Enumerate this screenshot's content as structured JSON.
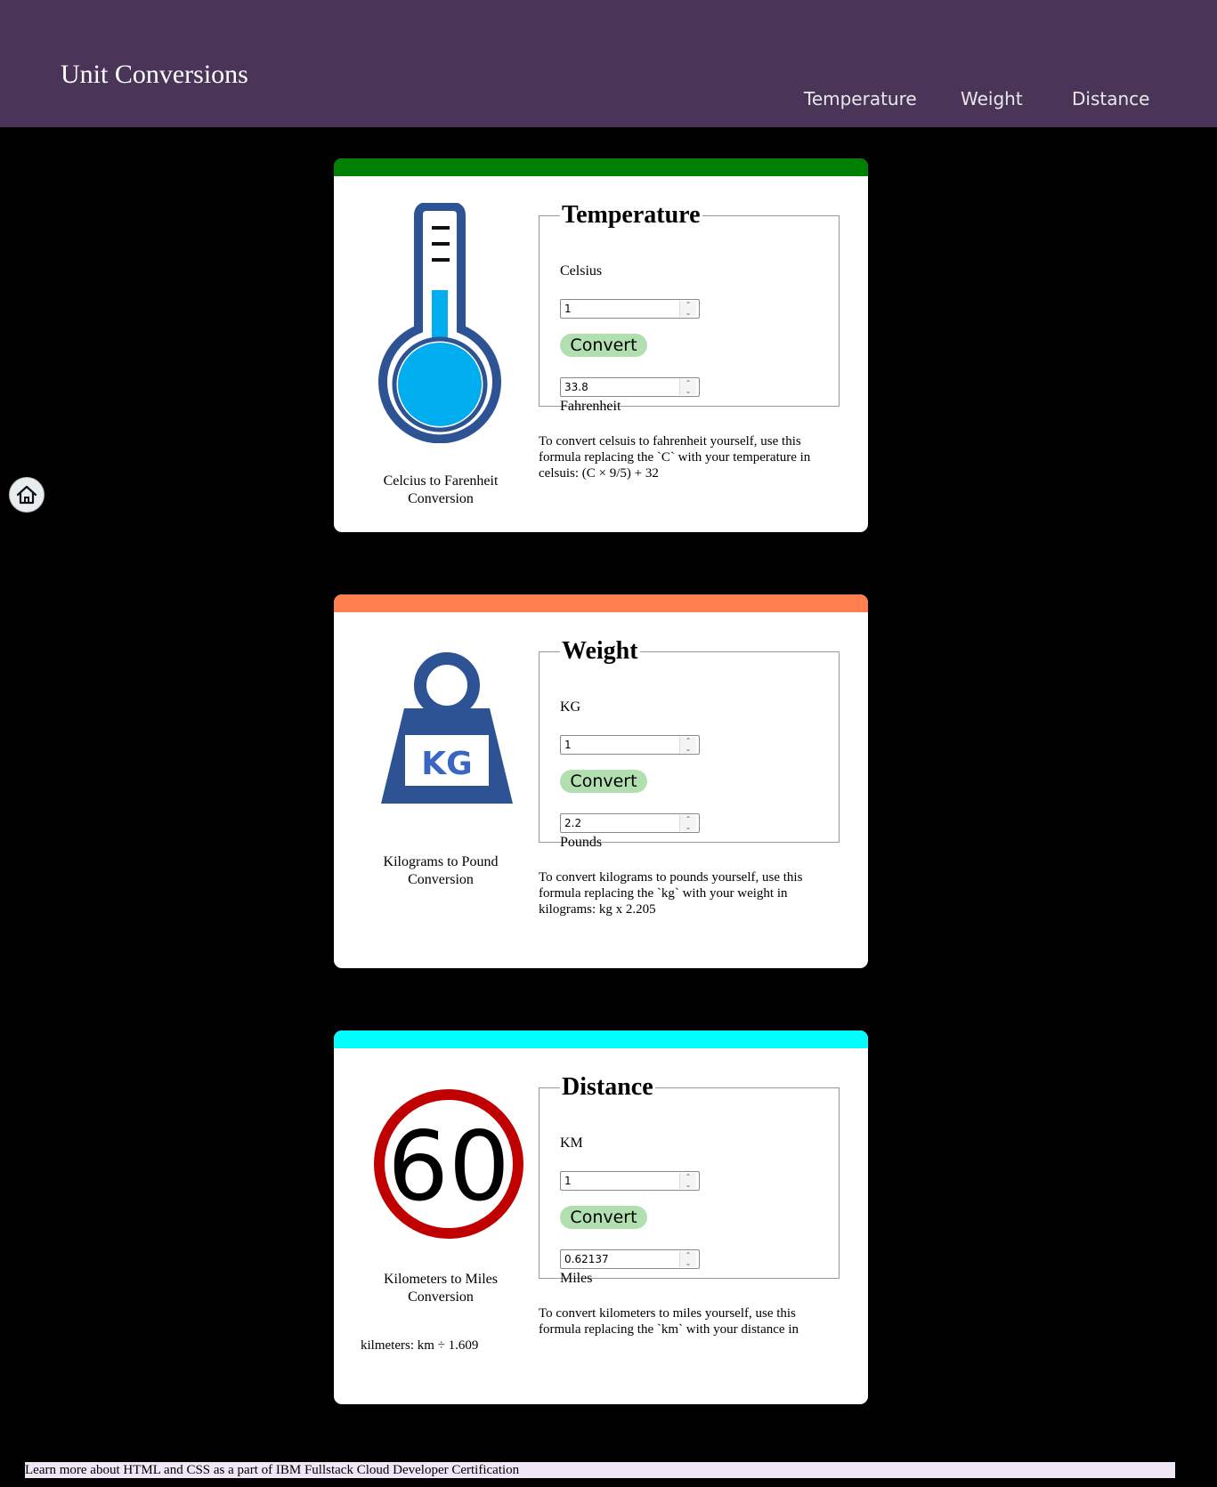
{
  "header": {
    "title": "Unit Conversions",
    "nav": [
      "Temperature",
      "Weight",
      "Distance"
    ]
  },
  "home": {
    "icon": "home-icon"
  },
  "temperature": {
    "accent": "#008000",
    "icon": "thermometer-icon",
    "caption": "Celcius to Farenheit Conversion",
    "legend": "Temperature",
    "from_label": "Celsius",
    "from_value": "1",
    "button": "Convert",
    "to_value": "33.8",
    "to_label": "Fahrenheit",
    "formula": "To convert celsuis to fahrenheit yourself, use this formula replacing the `C` with your temperature in celsuis: (C × 9/5) + 32"
  },
  "weight": {
    "accent": "#ff7f50",
    "icon": "kg-weight-icon",
    "icon_text": "KG",
    "caption": "Kilograms to Pound Conversion",
    "legend": "Weight",
    "from_label": "KG",
    "from_value": "1",
    "button": "Convert",
    "to_value": "2.2",
    "to_label": "Pounds",
    "formula": "To convert kilograms to pounds yourself, use this formula replacing the `kg` with your weight in kilograms: kg x 2.205"
  },
  "distance": {
    "accent": "#00ffff",
    "icon": "speed-limit-sign-icon",
    "icon_text": "60",
    "caption": "Kilometers to Miles Conversion",
    "legend": "Distance",
    "from_label": "KM",
    "from_value": "1",
    "button": "Convert",
    "to_value": "0.62137",
    "to_label": "Miles",
    "formula": "To convert kilometers to miles yourself, use this formula replacing the `km` with your distance in",
    "formula_overflow": "kilmeters: km ÷ 1.609"
  },
  "footer": {
    "text": "Learn more about HTML and CSS as a part of IBM Fullstack Cloud Developer Certification"
  }
}
